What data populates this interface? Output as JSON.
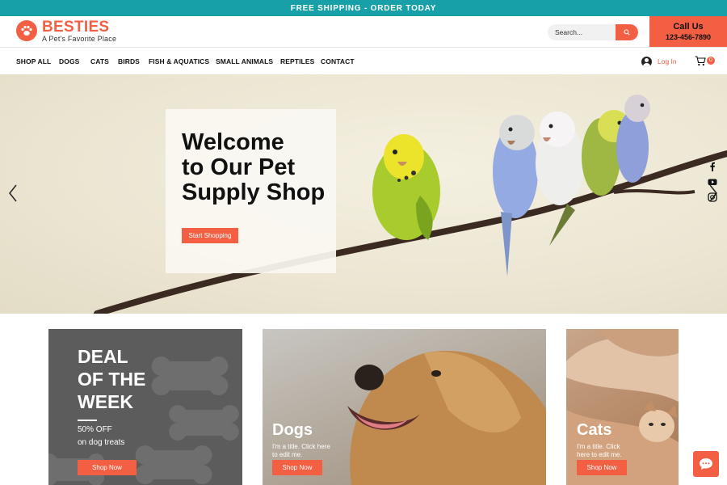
{
  "announcement": "FREE SHIPPING - ORDER TODAY",
  "brand": {
    "name": "BESTIES",
    "tagline": "A Pet's Favorite Place"
  },
  "search": {
    "placeholder": "Search..."
  },
  "call": {
    "title": "Call Us",
    "phone": "123-456-7890"
  },
  "nav": {
    "items": [
      "SHOP ALL",
      "DOGS",
      "CATS",
      "BIRDS",
      "FISH & AQUATICS",
      "SMALL ANIMALS",
      "REPTILES",
      "CONTACT"
    ],
    "login_label": "Log In",
    "cart_count": "0"
  },
  "hero": {
    "title_lines": [
      "Welcome",
      "to Our Pet",
      "Supply Shop"
    ],
    "cta": "Start Shopping"
  },
  "social": [
    "facebook-icon",
    "youtube-icon",
    "instagram-icon"
  ],
  "cards": {
    "deal": {
      "title_lines": [
        "DEAL",
        "OF THE",
        "WEEK"
      ],
      "discount": "50% OFF",
      "detail": "on dog treats",
      "button": "Shop Now"
    },
    "dogs": {
      "title": "Dogs",
      "subtitle_lines": [
        "I'm a title. Click here",
        "to edit me."
      ],
      "button": "Shop Now"
    },
    "cats": {
      "title": "Cats",
      "subtitle_lines": [
        "I'm a title. Click",
        "here to edit me."
      ],
      "button": "Shop Now"
    }
  },
  "colors": {
    "accent": "#f25f43",
    "topbar": "#17a0a8",
    "card_dark": "#5c5c5c"
  }
}
